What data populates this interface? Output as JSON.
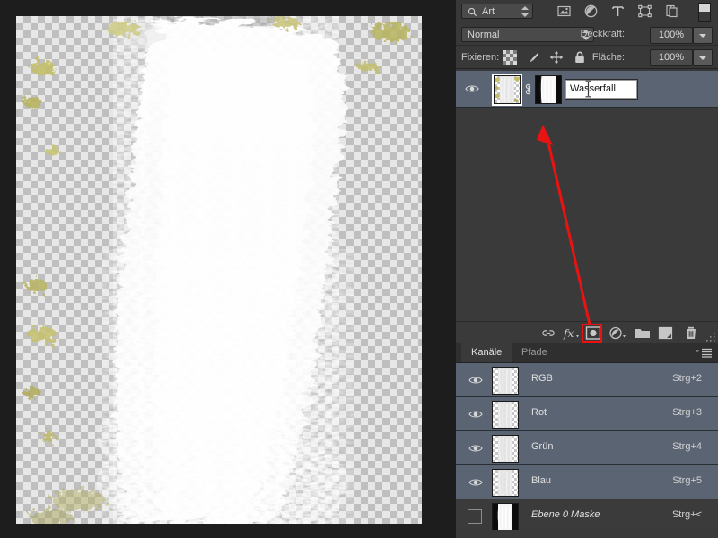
{
  "app": {
    "name": "Adobe Photoshop",
    "locale": "de",
    "accent_red": "#e81313",
    "panel_bg": "#383838",
    "row_selected_bg": "#5b6473"
  },
  "canvas": {
    "name": "document-canvas",
    "content_description": "Wasserfall auf transparentem Hintergrund",
    "transparency_grid": true
  },
  "layers_panel": {
    "filter": {
      "kind_label": "Art",
      "search_icon": "search-icon",
      "icons": [
        {
          "name": "filter-pixel-icon",
          "label": "Pixelebenen"
        },
        {
          "name": "filter-adjustment-icon",
          "label": "Einstellungsebenen"
        },
        {
          "name": "filter-type-icon",
          "label": "Textebenen"
        },
        {
          "name": "filter-shape-icon",
          "label": "Formebenen"
        },
        {
          "name": "filter-smartobject-icon",
          "label": "Smartobjekte"
        }
      ],
      "toggle_label": "Filter ein/aus"
    },
    "blend_mode": "Normal",
    "opacity_label": "Deckkraft:",
    "opacity_value": "100%",
    "lock_label": "Fixieren:",
    "lock_icons": [
      {
        "name": "lock-transparency-icon",
        "label": "Transparente Pixel fixieren"
      },
      {
        "name": "lock-image-icon",
        "label": "Bildpixel fixieren"
      },
      {
        "name": "lock-position-icon",
        "label": "Position fixieren"
      },
      {
        "name": "lock-all-icon",
        "label": "Alles fixieren"
      }
    ],
    "fill_label": "Fläche:",
    "fill_value": "100%",
    "layers": [
      {
        "name": "Wasserfall",
        "visible": true,
        "selected": true,
        "editing_name": true,
        "has_mask": true,
        "linked": true
      }
    ],
    "toolbar": [
      {
        "name": "link-layers-button",
        "label": "Ebenen verknüpfen"
      },
      {
        "name": "layer-style-button",
        "label": "fx"
      },
      {
        "name": "add-layer-mask-button",
        "label": "Ebenenmaske hinzufügen",
        "highlighted": true
      },
      {
        "name": "new-adjustment-layer-button",
        "label": "Neue Füll- oder Einstellungsebene"
      },
      {
        "name": "new-group-button",
        "label": "Neue Gruppe erstellen"
      },
      {
        "name": "new-layer-button",
        "label": "Neue Ebene erstellen"
      },
      {
        "name": "delete-layer-button",
        "label": "Ebene löschen"
      }
    ]
  },
  "channels_panel": {
    "tabs": [
      {
        "label": "Kanäle",
        "active": true
      },
      {
        "label": "Pfade",
        "active": false
      }
    ],
    "menu_icon": "panel-menu-icon",
    "channels": [
      {
        "name": "RGB",
        "shortcut": "Strg+2",
        "visible": true,
        "selected": true,
        "italic": false
      },
      {
        "name": "Rot",
        "shortcut": "Strg+3",
        "visible": true,
        "selected": true,
        "italic": false
      },
      {
        "name": "Grün",
        "shortcut": "Strg+4",
        "visible": true,
        "selected": true,
        "italic": false
      },
      {
        "name": "Blau",
        "shortcut": "Strg+5",
        "visible": true,
        "selected": true,
        "italic": false
      },
      {
        "name": "Ebene 0 Maske",
        "shortcut": "Strg+<",
        "visible": false,
        "selected": false,
        "italic": true
      }
    ]
  },
  "annotation": {
    "type": "arrow",
    "color": "#e81313",
    "points_from": "add-layer-mask-button",
    "points_to": "layer-row-wasserfall",
    "highlight_box": "add-layer-mask-button"
  }
}
